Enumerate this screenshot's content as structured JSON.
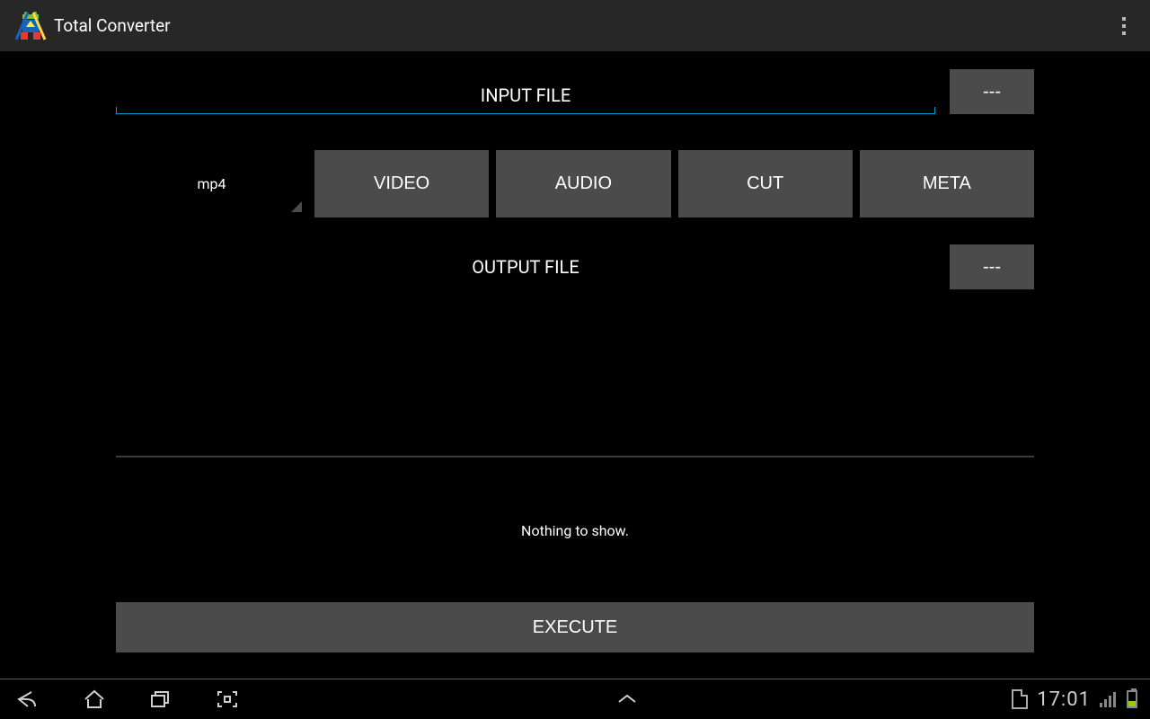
{
  "header": {
    "title": "Total Converter"
  },
  "input": {
    "hint": "INPUT FILE",
    "browse_label": "---"
  },
  "format": {
    "value": "mp4"
  },
  "tabs": {
    "video": "VIDEO",
    "audio": "AUDIO",
    "cut": "CUT",
    "meta": "META"
  },
  "output": {
    "label": "OUTPUT FILE",
    "browse_label": "---"
  },
  "status": {
    "text": "Nothing to show."
  },
  "execute": {
    "label": "EXECUTE"
  },
  "statusbar": {
    "clock": "17:01"
  }
}
